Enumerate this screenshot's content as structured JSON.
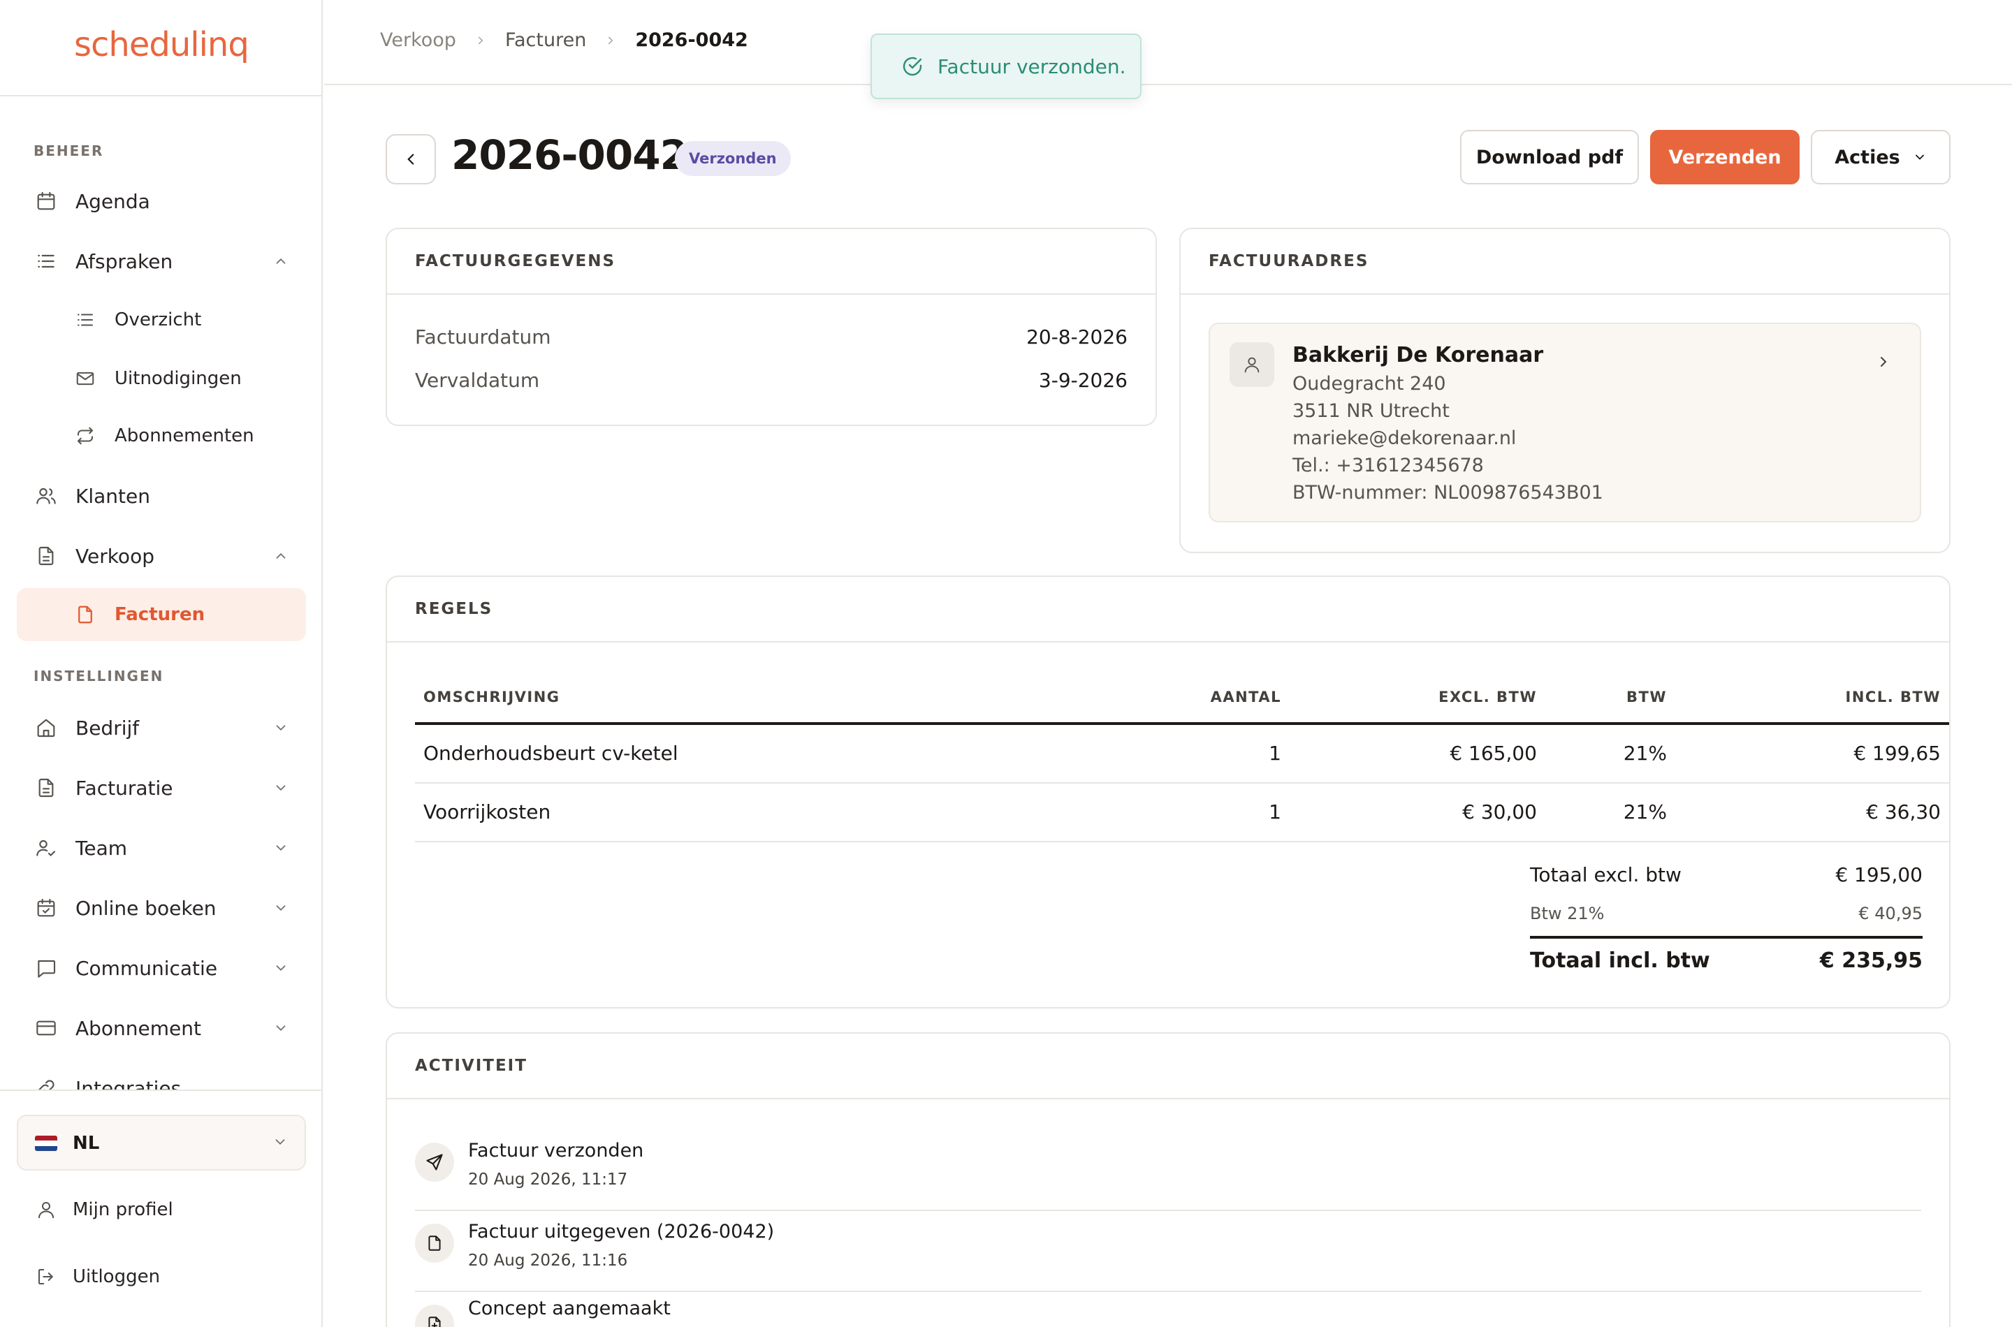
{
  "app": {
    "logo": "schedulinq",
    "accent": "#e8663e"
  },
  "sidebar": {
    "section_beheer": "BEHEER",
    "section_instellingen": "INSTELLINGEN",
    "items": [
      {
        "label": "Agenda",
        "icon": "calendar-icon"
      },
      {
        "label": "Afspraken",
        "icon": "list-icon"
      },
      {
        "label": "Overzicht",
        "icon": "list-icon"
      },
      {
        "label": "Uitnodigingen",
        "icon": "mail-icon"
      },
      {
        "label": "Abonnementen",
        "icon": "repeat-icon"
      },
      {
        "label": "Klanten",
        "icon": "users-icon"
      },
      {
        "label": "Verkoop",
        "icon": "document-icon"
      },
      {
        "label": "Facturen",
        "icon": "document-icon"
      },
      {
        "label": "Bedrijf",
        "icon": "home-icon"
      },
      {
        "label": "Facturatie",
        "icon": "document-icon"
      },
      {
        "label": "Team",
        "icon": "user-check-icon"
      },
      {
        "label": "Online boeken",
        "icon": "calendar-check-icon"
      },
      {
        "label": "Communicatie",
        "icon": "chat-icon"
      },
      {
        "label": "Abonnement",
        "icon": "credit-card-icon"
      },
      {
        "label": "Integraties",
        "icon": "link-icon"
      }
    ],
    "language": "NL",
    "profile": "Mijn profiel",
    "logout": "Uitloggen"
  },
  "breadcrumb": [
    "Verkoop",
    "Facturen",
    "2026-0042"
  ],
  "toast": {
    "message": "Factuur verzonden."
  },
  "header": {
    "title": "2026-0042",
    "status": "Verzonden",
    "download_label": "Download pdf",
    "send_label": "Verzenden",
    "actions_label": "Acties"
  },
  "invoice_details": {
    "heading": "FACTUURGEGEVENS",
    "rows": [
      {
        "label": "Factuurdatum",
        "value": "20-8-2026"
      },
      {
        "label": "Vervaldatum",
        "value": "3-9-2026"
      }
    ]
  },
  "billing_address": {
    "heading": "FACTUURADRES",
    "name": "Bakkerij De Korenaar",
    "lines": [
      "Oudegracht 240",
      "3511 NR Utrecht",
      "marieke@dekorenaar.nl",
      "Tel.: +31612345678",
      "BTW-nummer: NL009876543B01"
    ]
  },
  "lines": {
    "heading": "REGELS",
    "columns": [
      "OMSCHRIJVING",
      "AANTAL",
      "EXCL. BTW",
      "BTW",
      "INCL. BTW"
    ],
    "rows": [
      [
        "Onderhoudsbeurt cv-ketel",
        "1",
        "€ 165,00",
        "21%",
        "€ 199,65"
      ],
      [
        "Voorrijkosten",
        "1",
        "€ 30,00",
        "21%",
        "€ 36,30"
      ]
    ],
    "subtotal_label": "Totaal excl. btw",
    "subtotal_value": "€ 195,00",
    "vat_label": "Btw 21%",
    "vat_value": "€ 40,95",
    "total_label": "Totaal incl. btw",
    "total_value": "€ 235,95"
  },
  "activity": {
    "heading": "ACTIVITEIT",
    "items": [
      {
        "title": "Factuur verzonden",
        "time": "20 Aug 2026, 11:17",
        "icon": "send-icon"
      },
      {
        "title": "Factuur uitgegeven (2026-0042)",
        "time": "20 Aug 2026, 11:16",
        "icon": "document-icon"
      },
      {
        "title": "Concept aangemaakt",
        "time": "",
        "icon": "document-plus-icon"
      }
    ]
  }
}
